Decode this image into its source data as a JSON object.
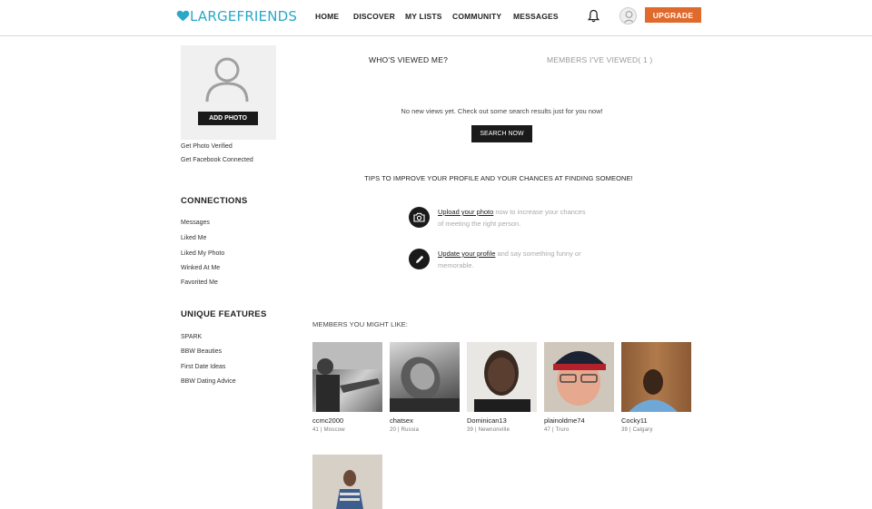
{
  "header": {
    "logo": "LARGEFRIENDS",
    "nav": [
      "HOME",
      "DISCOVER",
      "MY LISTS",
      "COMMUNITY",
      "MESSAGES"
    ],
    "upgrade": "UPGRADE",
    "icons": [
      "bell-icon",
      "user-avatar-icon"
    ]
  },
  "sidebar": {
    "add_photo": "ADD PHOTO",
    "links_top": [
      "Get Photo Verified",
      "Get Facebook Connected"
    ],
    "connections_title": "CONNECTIONS",
    "connections": [
      "Messages",
      "Liked Me",
      "Liked My Photo",
      "Winked At Me",
      "Favorited Me"
    ],
    "features_title": "UNIQUE FEATURES",
    "features": [
      "SPARK",
      "BBW Beauties",
      "First Date Ideas",
      "BBW Dating Advice"
    ]
  },
  "main": {
    "tab_viewed_me": "WHO'S VIEWED ME?",
    "tab_i_viewed": "MEMBERS I'VE VIEWED( 1 )",
    "no_views": "No new views yet. Check out some search results just for you now!",
    "search_now": "SEARCH NOW",
    "tips_title": "TIPS TO IMPROVE YOUR PROFILE AND YOUR CHANCES AT FINDING SOMEONE!",
    "tips": [
      {
        "link": "Upload your photo",
        "text": " now to increase your chances of meeting the right person.",
        "icon": "camera-icon"
      },
      {
        "link": "Update your profile",
        "text": " and say something funny or memorable.",
        "icon": "pencil-icon"
      }
    ],
    "members_label": "MEMBERS YOU MIGHT LIKE:",
    "members": [
      {
        "name": "ccmc2000",
        "info": "41 | Moscow"
      },
      {
        "name": "chatsex",
        "info": "20 | Russia"
      },
      {
        "name": "Dominican13",
        "info": "39 | Newnonville"
      },
      {
        "name": "plainoldme74",
        "info": "47 | Truro"
      },
      {
        "name": "Cocky11",
        "info": "39 | Calgary"
      },
      {
        "name": "",
        "info": ""
      }
    ]
  },
  "colors": {
    "brand": "#2aa8c9",
    "upgrade": "#e0692c",
    "dark_button": "#1a1a1a"
  }
}
